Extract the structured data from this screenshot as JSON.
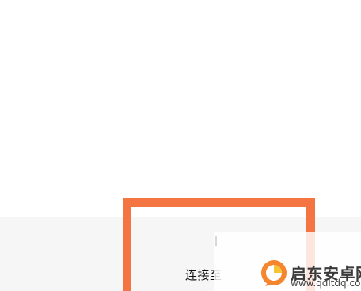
{
  "panel": {
    "item": {
      "icon": "wifi-icon",
      "label": "连接至"
    }
  },
  "watermark": {
    "name": "启东安卓网",
    "url": "www.qdltdq.com"
  },
  "colors": {
    "highlight": "#f47442",
    "panel_background": "#f6f6f6",
    "page_background": "#ffffff",
    "logo_orange": "#f6852f",
    "logo_yellow": "#f7c233"
  }
}
